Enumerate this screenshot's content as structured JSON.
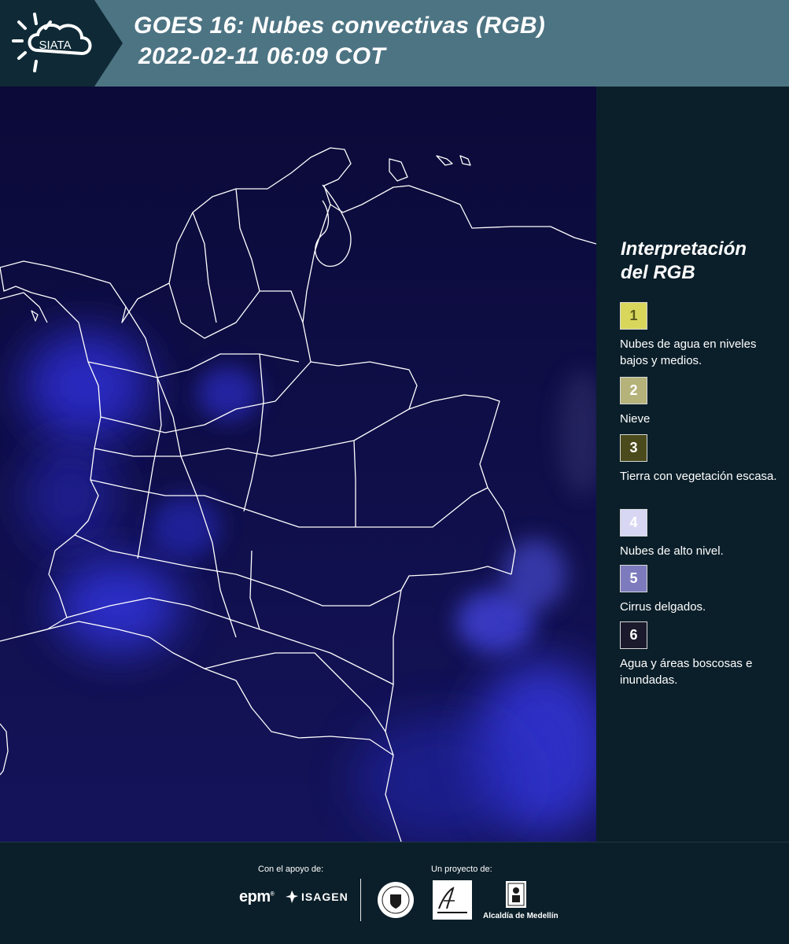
{
  "header": {
    "logo_text": "SIATA",
    "title_line1": "GOES 16: Nubes convectivas (RGB)",
    "title_line2": "2022-02-11 06:09 COT"
  },
  "legend": {
    "title_line1": "Interpretación",
    "title_line2": "del RGB",
    "items": [
      {
        "number": "1",
        "label": "Nubes de agua en niveles bajos y medios.",
        "color": "#d9d65c",
        "text_color": "#5b5a1c"
      },
      {
        "number": "2",
        "label": "Nieve",
        "color": "#b5b27a",
        "text_color": "#ffffff"
      },
      {
        "number": "3",
        "label": "Tierra con vegetación escasa.",
        "color": "#4a4a1c",
        "text_color": "#ffffff"
      },
      {
        "number": "4",
        "label": "Nubes de alto nivel.",
        "color": "#d7d7f3",
        "text_color": "#ffffff"
      },
      {
        "number": "5",
        "label": "Cirrus delgados.",
        "color": "#7d7bbd",
        "text_color": "#ffffff"
      },
      {
        "number": "6",
        "label": "Agua y áreas boscosas e inundadas.",
        "color": "#1b1a2c",
        "text_color": "#ffffff"
      }
    ]
  },
  "footer": {
    "support_label": "Con el apoyo de:",
    "project_label": "Un proyecto de:",
    "epm_text": "epm",
    "isagen_text": "ISAGEN",
    "alcaldia_text": "Alcaldía de Medellín"
  },
  "colors": {
    "header_band": "#4d7483",
    "panel_bg": "#0b1f2a",
    "map_bg": "#0c0b3c",
    "cloud_blue": "#3a3cff",
    "border_lines": "#ffffff"
  }
}
